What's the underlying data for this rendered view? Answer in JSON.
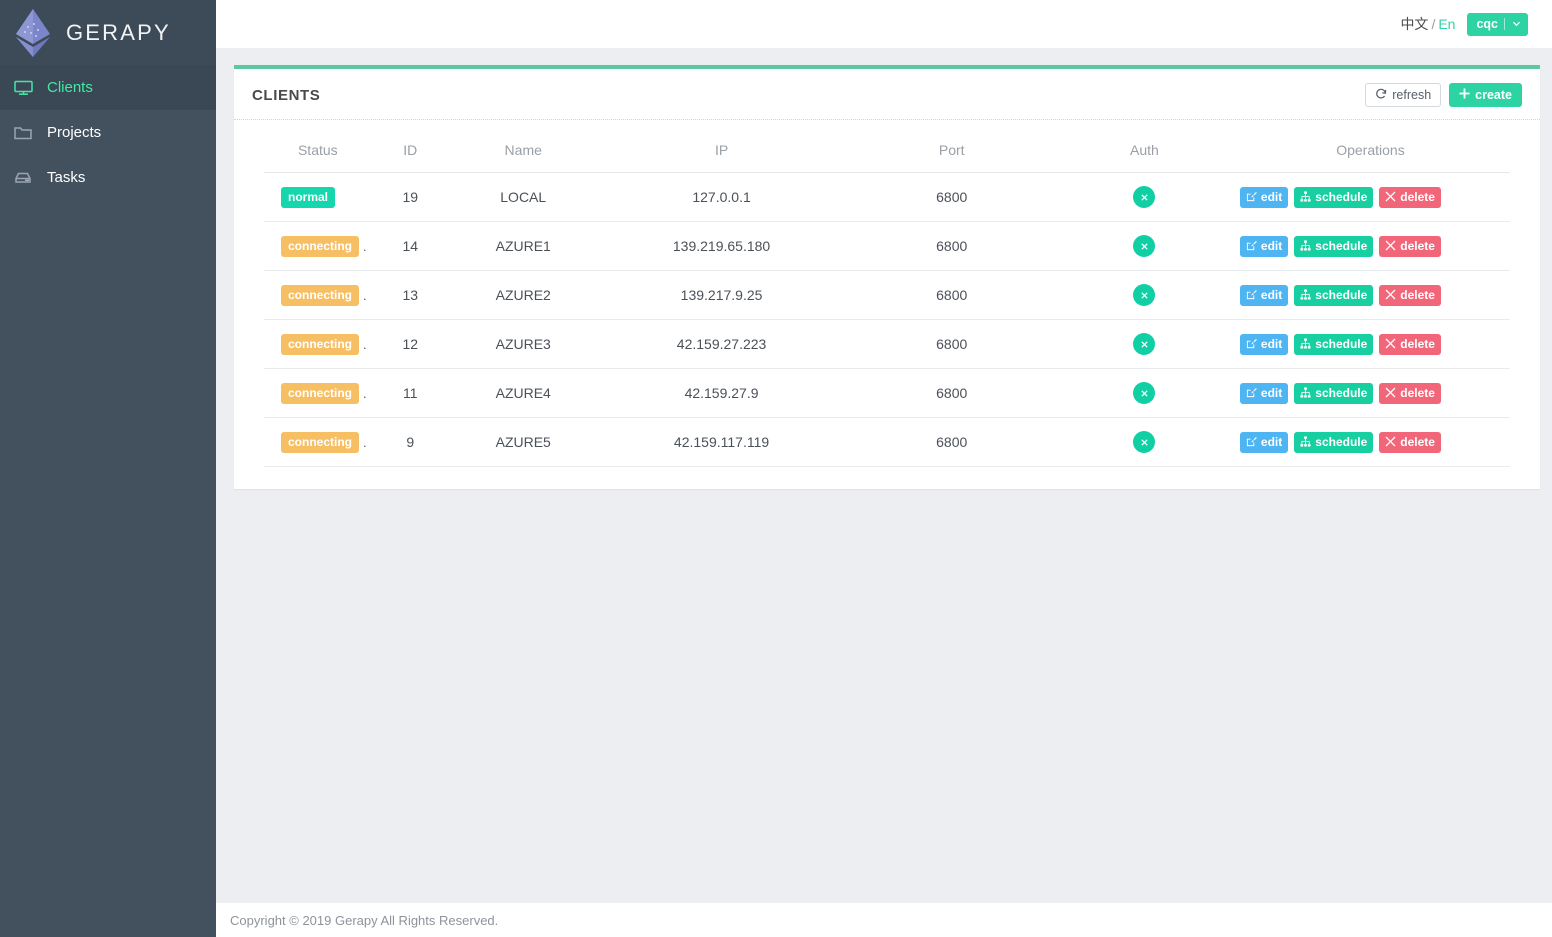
{
  "sidebar": {
    "brand": {
      "name": "GERAPY",
      "logo_icon": "ethereum-diamond-icon"
    },
    "items": [
      {
        "label": "Clients",
        "icon": "monitor-icon",
        "active": true
      },
      {
        "label": "Projects",
        "icon": "folder-icon",
        "active": false
      },
      {
        "label": "Tasks",
        "icon": "hard-drive-icon",
        "active": false
      }
    ]
  },
  "topbar": {
    "lang_zh": "中文",
    "lang_sep": "/",
    "lang_en": "En",
    "user": "cqc",
    "user_caret_icon": "chevron-down-icon"
  },
  "card": {
    "title": "CLIENTS",
    "accent_color": "#5ac8a0",
    "refresh_label": "refresh",
    "refresh_icon": "refresh-icon",
    "create_label": "create",
    "create_icon": "plus-icon"
  },
  "table": {
    "columns": [
      "Status",
      "ID",
      "Name",
      "IP",
      "Port",
      "Auth",
      "Operations"
    ],
    "auth_icon": "times-circle-icon",
    "ops": {
      "edit_label": "edit",
      "edit_icon": "pencil-square-icon",
      "edit_color": "#4fb4f2",
      "schedule_label": "schedule",
      "schedule_icon": "sitemap-icon",
      "schedule_color": "#18cfa1",
      "delete_label": "delete",
      "delete_icon": "times-icon",
      "delete_color": "#f2667a"
    },
    "status_colors": {
      "normal": "#14d7ad",
      "connecting": "#f7bf63"
    },
    "rows": [
      {
        "status": "normal",
        "status_kind": "normal",
        "dot": "",
        "id": "19",
        "name": "LOCAL",
        "ip": "127.0.0.1",
        "port": "6800"
      },
      {
        "status": "connecting",
        "status_kind": "connecting",
        "dot": ".",
        "id": "14",
        "name": "AZURE1",
        "ip": "139.219.65.180",
        "port": "6800"
      },
      {
        "status": "connecting",
        "status_kind": "connecting",
        "dot": ".",
        "id": "13",
        "name": "AZURE2",
        "ip": "139.217.9.25",
        "port": "6800"
      },
      {
        "status": "connecting",
        "status_kind": "connecting",
        "dot": ".",
        "id": "12",
        "name": "AZURE3",
        "ip": "42.159.27.223",
        "port": "6800"
      },
      {
        "status": "connecting",
        "status_kind": "connecting",
        "dot": ".",
        "id": "11",
        "name": "AZURE4",
        "ip": "42.159.27.9",
        "port": "6800"
      },
      {
        "status": "connecting",
        "status_kind": "connecting",
        "dot": ".",
        "id": "9",
        "name": "AZURE5",
        "ip": "42.159.117.119",
        "port": "6800"
      }
    ]
  },
  "footer": {
    "copyright": "Copyright © 2019 Gerapy All Rights Reserved."
  }
}
